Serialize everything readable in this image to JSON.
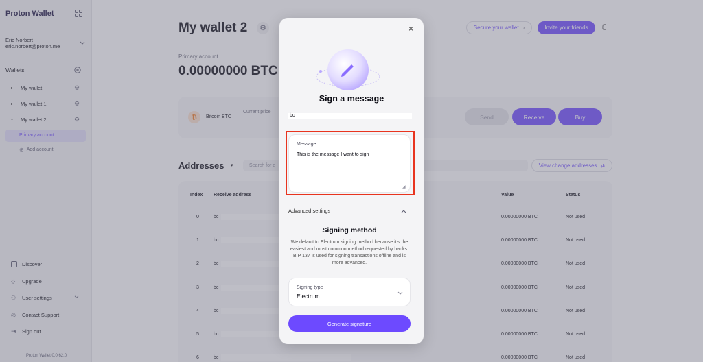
{
  "app": {
    "brand": "Proton Wallet",
    "version": "Proton Wallet 0.0.62.0"
  },
  "user": {
    "name": "Eric Norbert",
    "email": "eric.norbert@proton.me"
  },
  "sidebar": {
    "wallets_heading": "Wallets",
    "wallets": [
      {
        "label": "My wallet",
        "expanded": false
      },
      {
        "label": "My wallet 1",
        "expanded": false
      },
      {
        "label": "My wallet 2",
        "expanded": true
      }
    ],
    "primary_account": "Primary account",
    "add_account": "Add account",
    "bottom": [
      {
        "label": "Discover",
        "icon": "discover-icon"
      },
      {
        "label": "Upgrade",
        "icon": "diamond-icon"
      },
      {
        "label": "User settings",
        "icon": "user-icon"
      },
      {
        "label": "Contact Support",
        "icon": "support-icon"
      },
      {
        "label": "Sign out",
        "icon": "sign-out-icon"
      }
    ]
  },
  "header": {
    "title": "My wallet 2",
    "secure_wallet": "Secure your wallet",
    "invite_friends": "Invite your friends"
  },
  "balance": {
    "label": "Primary account",
    "value": "0.00000000 BTC"
  },
  "price_card": {
    "asset": "Bitcoin BTC",
    "current_price_label": "Current price",
    "send": "Send",
    "receive": "Receive",
    "buy": "Buy"
  },
  "addresses": {
    "title": "Addresses",
    "search_placeholder": "Search for e",
    "view_change": "View change addresses",
    "columns": {
      "index": "Index",
      "address": "Receive address",
      "value": "Value",
      "status": "Status"
    },
    "rows": [
      {
        "index": "0",
        "address": "bc",
        "value": "0.00000000 BTC",
        "status": "Not used"
      },
      {
        "index": "1",
        "address": "bc",
        "value": "0.00000000 BTC",
        "status": "Not used"
      },
      {
        "index": "2",
        "address": "bc",
        "value": "0.00000000 BTC",
        "status": "Not used"
      },
      {
        "index": "3",
        "address": "bc",
        "value": "0.00000000 BTC",
        "status": "Not used"
      },
      {
        "index": "4",
        "address": "bc",
        "value": "0.00000000 BTC",
        "status": "Not used"
      },
      {
        "index": "5",
        "address": "bc",
        "value": "0.00000000 BTC",
        "status": "Not used"
      },
      {
        "index": "6",
        "address": "bc",
        "value": "0.00000000 BTC",
        "status": "Not used"
      }
    ]
  },
  "modal": {
    "title": "Sign a message",
    "address": "bc",
    "message_label": "Message",
    "message_value": "This is the message I want to sign",
    "advanced_settings": "Advanced settings",
    "signing_method_title": "Signing method",
    "signing_method_desc": "We default to Electrum signing method because it's the easiest and most common method requested by banks. BIP 137 is used for signing transactions offline and is more advanced.",
    "signing_type_label": "Signing type",
    "signing_type_value": "Electrum",
    "generate": "Generate signature"
  },
  "colors": {
    "accent": "#6d4aff",
    "highlight": "#e8341f",
    "overlay": "#6e6e80"
  }
}
